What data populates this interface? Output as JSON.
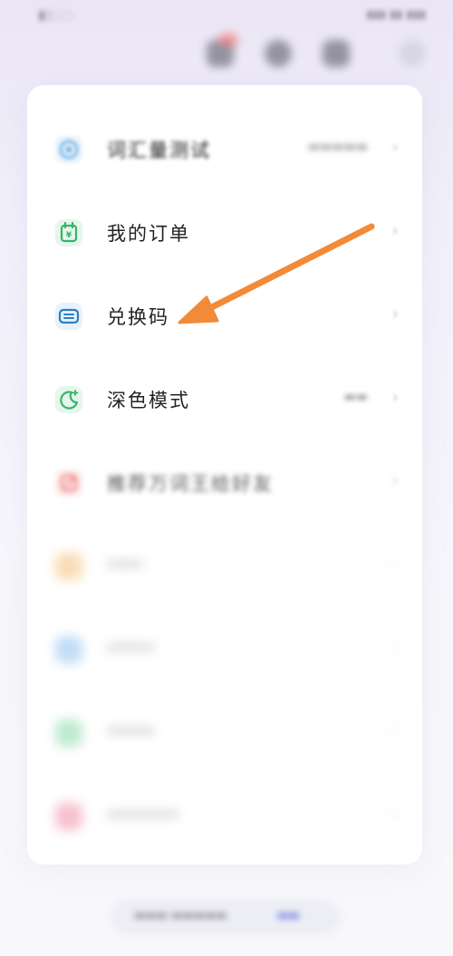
{
  "colors": {
    "accent_arrow": "#f28a37",
    "icon_blue": "#4a9ed8",
    "icon_green": "#34b56a",
    "icon_red": "#ee6b6b",
    "icon_orange": "#f2b96a",
    "icon_lightblue": "#7fbaf0",
    "icon_lightgreen": "#7cd4a0",
    "icon_pink": "#f07fa0"
  },
  "menu": {
    "items": [
      {
        "label": "词汇量测试",
        "icon": "target-icon",
        "value": "",
        "chevron": "›"
      },
      {
        "label": "我的订单",
        "icon": "order-icon",
        "value": "",
        "chevron": "›"
      },
      {
        "label": "兑换码",
        "icon": "ticket-icon",
        "value": "",
        "chevron": "›"
      },
      {
        "label": "深色模式",
        "icon": "moon-icon",
        "value": "",
        "chevron": "›"
      },
      {
        "label": "推荐万词王给好友",
        "icon": "share-icon",
        "value": "",
        "chevron": "›"
      },
      {
        "label": "",
        "icon": "star-icon",
        "value": "",
        "chevron": "›"
      },
      {
        "label": "",
        "icon": "help-icon",
        "value": "",
        "chevron": "›"
      },
      {
        "label": "",
        "icon": "info-icon",
        "value": "",
        "chevron": "›"
      },
      {
        "label": "",
        "icon": "user-icon",
        "value": "",
        "chevron": "›"
      }
    ]
  },
  "annotation": {
    "arrow_icon": "arrow-pointer-icon"
  }
}
